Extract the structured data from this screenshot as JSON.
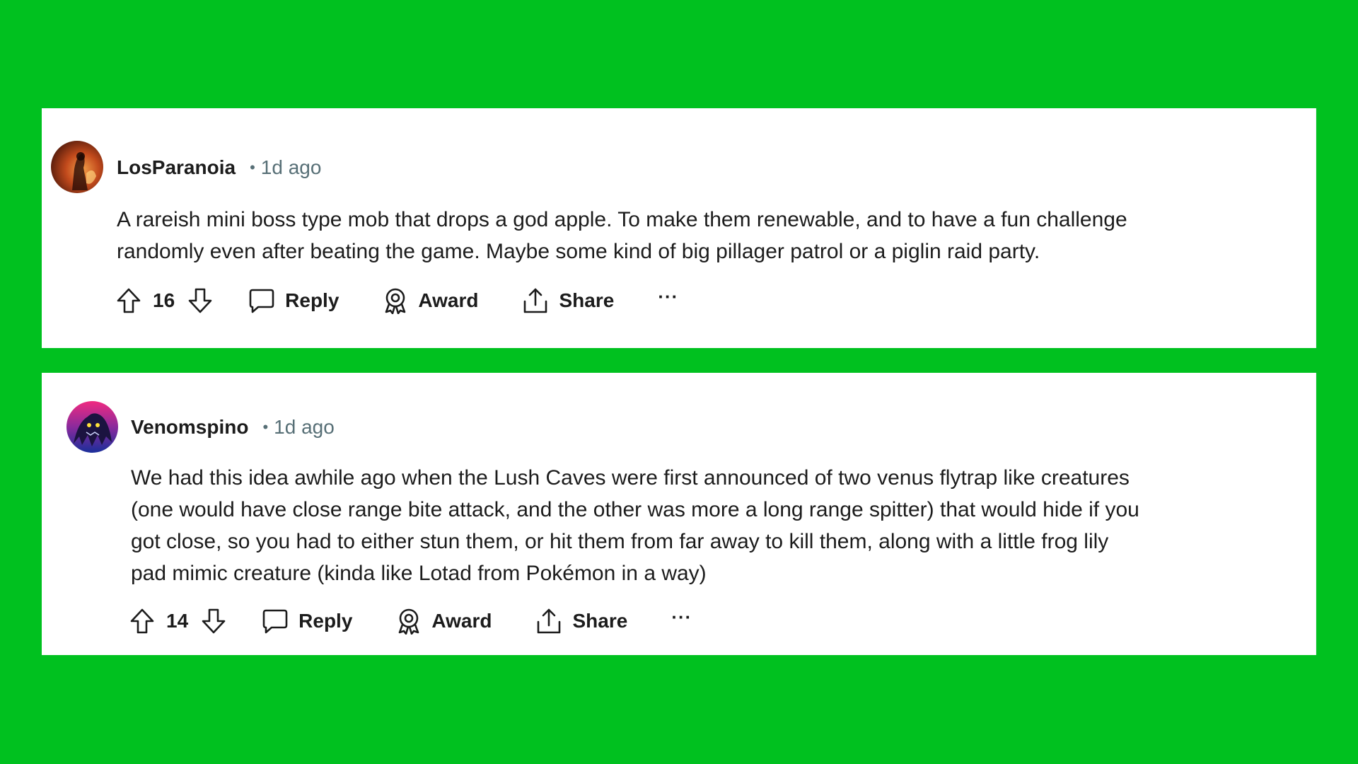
{
  "page": {
    "background_color": "#00c11f"
  },
  "comments": [
    {
      "username": "LosParanoia",
      "timestamp": "1d ago",
      "separator": "•",
      "lines": [
        "A rareish mini boss type mob that drops a god apple. To make them renewable, and to have a fun challenge",
        "randomly even after beating the game. Maybe some kind of big pillager patrol or a piglin raid party."
      ],
      "votes": "16",
      "avatar_colors": [
        "#f0773a",
        "#7a2410"
      ]
    },
    {
      "username": "Venomspino",
      "timestamp": "1d ago",
      "separator": "•",
      "lines": [
        "We had this idea awhile ago when the Lush Caves were first announced of two venus flytrap like creatures",
        "(one would have close range bite attack, and the other was more a long range spitter) that would hide if you",
        "got close, so you had to either stun them, or hit them from far away to kill them, along with a little frog lily",
        "pad mimic creature (kinda like Lotad from Pokémon in a way)"
      ],
      "votes": "14",
      "avatar_colors": [
        "#e0287a",
        "#1c2a8c"
      ]
    }
  ],
  "actions": {
    "reply_label": "Reply",
    "award_label": "Award",
    "share_label": "Share",
    "more_label": "···"
  },
  "icons": {
    "upvote": "arrow-up-icon",
    "downvote": "arrow-down-icon",
    "reply": "comment-bubble-icon",
    "award": "award-ribbon-icon",
    "share": "share-upload-icon",
    "more": "ellipsis-icon"
  }
}
